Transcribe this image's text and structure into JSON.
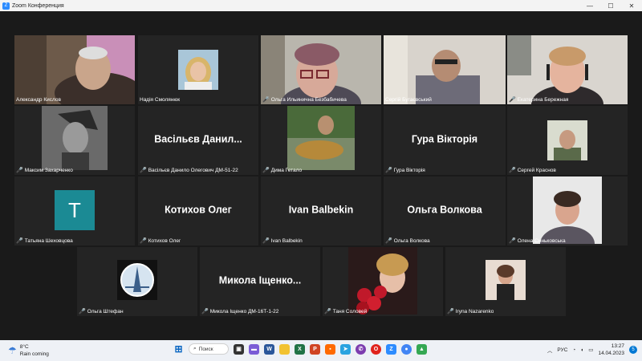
{
  "window": {
    "title": "Zoom Конференция",
    "logo": "Z"
  },
  "controls": {
    "minimize": "—",
    "maximize": "☐",
    "close": "✕"
  },
  "participants": [
    {
      "name": "Александр Кислов",
      "muted": false,
      "video": true
    },
    {
      "name": "Надія Смолянюк",
      "muted": false,
      "video": true
    },
    {
      "name": "Ольга  Ильинична Безбабичева",
      "muted": true,
      "video": true
    },
    {
      "name": "Сергій Бугаєвський",
      "muted": false,
      "video": true,
      "active_speaker": true
    },
    {
      "name": "Екатерина Бережная",
      "muted": true,
      "video": true
    },
    {
      "name": "Максим Захарченко",
      "muted": true,
      "video": true
    },
    {
      "name": "Васільєв Данило Олегович ДМ-51-22",
      "display": "Васільєв Данил...",
      "muted": true,
      "video": false
    },
    {
      "name": "Дима Гетало",
      "muted": true,
      "video": true
    },
    {
      "name": "Гура Вікторія",
      "display": "Гура Вікторія",
      "muted": true,
      "video": false
    },
    {
      "name": "Сергей Краснов",
      "muted": true,
      "video": true
    },
    {
      "name": "Татьяна Шеховцова",
      "muted": true,
      "video": true,
      "letter": "T"
    },
    {
      "name": "Котихов Олег",
      "display": "Котихов Олег",
      "muted": true,
      "video": false
    },
    {
      "name": "Ivan Balbekin",
      "display": "Ivan Balbekin",
      "muted": true,
      "video": false
    },
    {
      "name": "Ольга Волкова",
      "display": "Ольга Волкова",
      "muted": true,
      "video": false
    },
    {
      "name": "Олена Синьковська",
      "muted": true,
      "video": true
    },
    {
      "name": "Ольга Штефан",
      "muted": true,
      "video": true
    },
    {
      "name": "Микола Іщенко ДМ-16Т-1-22",
      "display": "Микола Іщенко...",
      "muted": true,
      "video": false
    },
    {
      "name": "Таня Соловей",
      "muted": true,
      "video": true
    },
    {
      "name": "Iryna Nazarenko",
      "muted": true,
      "video": true
    }
  ],
  "taskbar": {
    "weather_temp": "8°C",
    "weather_desc": "Rain coming",
    "search_label": "Поиск",
    "lang": "РУС",
    "time": "13:27",
    "date": "14.04.2023",
    "notif_count": "5",
    "app_labels": {
      "word": "W",
      "excel": "X",
      "powerpoint": "P",
      "opera": "O",
      "zoom": "Z"
    }
  }
}
